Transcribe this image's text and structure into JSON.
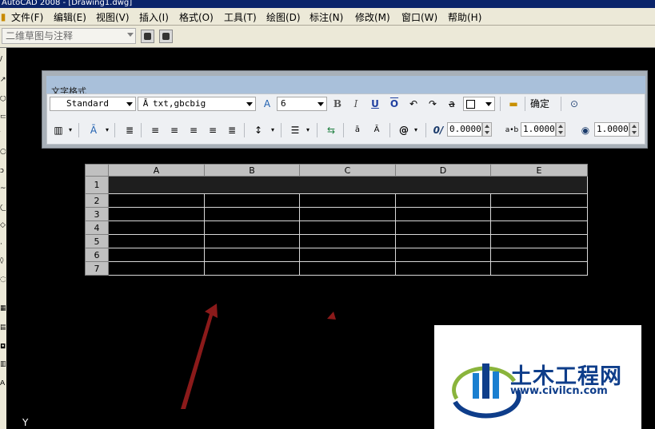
{
  "window": {
    "title": "AutoCAD 2008 - [Drawing1.dwg]"
  },
  "menu": [
    "文件(F)",
    "编辑(E)",
    "视图(V)",
    "插入(I)",
    "格式(O)",
    "工具(T)",
    "绘图(D)",
    "标注(N)",
    "修改(M)",
    "窗口(W)",
    "帮助(H)"
  ],
  "workspace": {
    "value": "二维草图与注释"
  },
  "text_format": {
    "title": "文字格式",
    "style": "Standard",
    "font": "txt,gbcbig",
    "height": "6",
    "ok_label": "确定",
    "oblique_value": "0.0000",
    "tracking_value": "1.0000",
    "width_value": "1.0000"
  },
  "table": {
    "columns": [
      "A",
      "B",
      "C",
      "D",
      "E"
    ],
    "rows": [
      "1",
      "2",
      "3",
      "4",
      "5",
      "6",
      "7"
    ],
    "selected_row": "1"
  },
  "ucs": {
    "y_label": "Y"
  },
  "logo": {
    "name": "土木工程网",
    "url": "www.civilcn.com"
  },
  "colors": {
    "arrow": "#8b1a1a",
    "canvas": "#000000",
    "logo_blue": "#0e3d8a"
  }
}
